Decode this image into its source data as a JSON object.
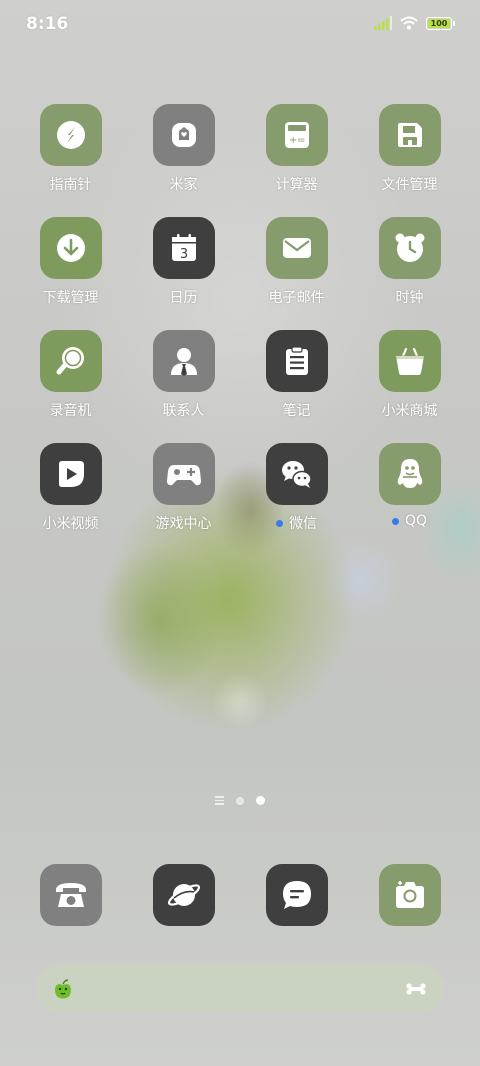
{
  "status_bar": {
    "time": "8:16",
    "battery_text": "100",
    "battery_level": 1.0,
    "icons": [
      "signal-icon",
      "wifi-icon",
      "battery-icon"
    ]
  },
  "apps": [
    {
      "label": "指南针",
      "icon": "compass-icon",
      "bg": "#869c6c"
    },
    {
      "label": "米家",
      "icon": "mijia-icon",
      "bg": "#808080"
    },
    {
      "label": "计算器",
      "icon": "calculator-icon",
      "bg": "#869c6c"
    },
    {
      "label": "文件管理",
      "icon": "file-manager-icon",
      "bg": "#869c6c"
    },
    {
      "label": "下载管理",
      "icon": "download-icon",
      "bg": "#7f9a5d"
    },
    {
      "label": "日历",
      "icon": "calendar-icon",
      "bg": "#3f3f3f",
      "calendar_day": "3"
    },
    {
      "label": "电子邮件",
      "icon": "email-icon",
      "bg": "#869c6c"
    },
    {
      "label": "时钟",
      "icon": "clock-icon",
      "bg": "#869c6c"
    },
    {
      "label": "录音机",
      "icon": "recorder-icon",
      "bg": "#7f9a5d"
    },
    {
      "label": "联系人",
      "icon": "contacts-icon",
      "bg": "#808080"
    },
    {
      "label": "笔记",
      "icon": "notes-icon",
      "bg": "#3f3f3f"
    },
    {
      "label": "小米商城",
      "icon": "shop-basket-icon",
      "bg": "#7f9a5d"
    },
    {
      "label": "小米视频",
      "icon": "video-play-icon",
      "bg": "#3f3f3f"
    },
    {
      "label": "游戏中心",
      "icon": "gamepad-icon",
      "bg": "#808080"
    },
    {
      "label": "微信",
      "icon": "wechat-icon",
      "bg": "#3f3f3f",
      "notification_dot": true
    },
    {
      "label": "QQ",
      "icon": "qq-penguin-icon",
      "bg": "#869c6c",
      "notification_dot": true
    }
  ],
  "page_indicator": {
    "pages": 2,
    "active_page": 2
  },
  "dock": [
    {
      "icon": "phone-icon",
      "bg": "#808080"
    },
    {
      "icon": "browser-icon",
      "bg": "#3f3f3f"
    },
    {
      "icon": "messages-icon",
      "bg": "#3f3f3f"
    },
    {
      "icon": "camera-icon",
      "bg": "#869c6c"
    }
  ],
  "search_bar": {
    "logo": "green-apple-icon",
    "voice": "voice-icon"
  },
  "colors": {
    "icon_green": "#869c6c",
    "icon_grey": "#808080",
    "icon_dark": "#3f3f3f",
    "notification_blue": "#3a7bea",
    "battery_green": "#b9e24a"
  }
}
